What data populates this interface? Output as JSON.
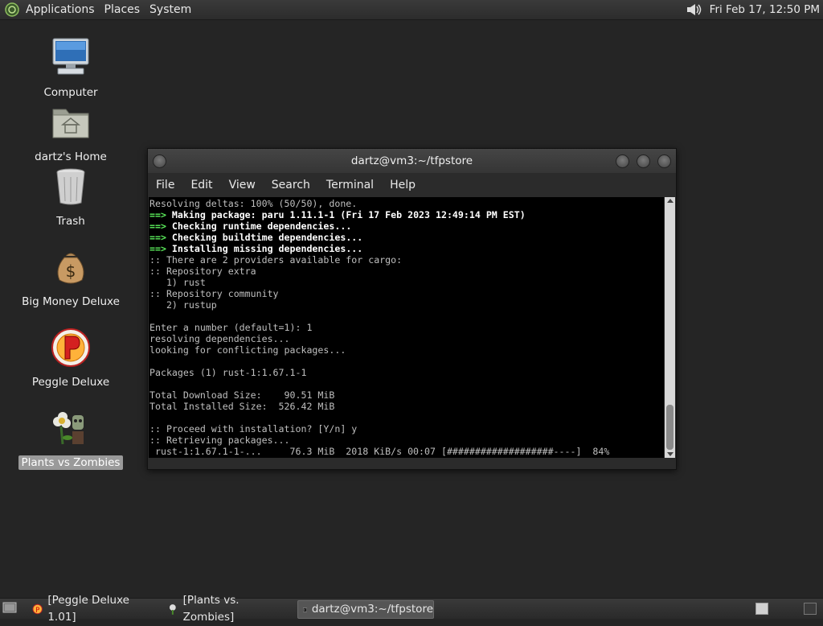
{
  "top_panel": {
    "menus": [
      "Applications",
      "Places",
      "System"
    ],
    "clock": "Fri Feb 17, 12:50 PM"
  },
  "desktop": {
    "icons": [
      {
        "label": "Computer",
        "icon": "computer-icon"
      },
      {
        "label": "dartz's Home",
        "icon": "home-folder-icon"
      },
      {
        "label": "Trash",
        "icon": "trash-icon"
      },
      {
        "label": "Big Money Deluxe",
        "icon": "money-bag-icon"
      },
      {
        "label": "Peggle Deluxe",
        "icon": "peggle-icon"
      },
      {
        "label": "Plants vs Zombies",
        "icon": "plants-vs-zombies-icon",
        "selected": true
      }
    ]
  },
  "terminal": {
    "title": "dartz@vm3:~/tfpstore",
    "menu": [
      "File",
      "Edit",
      "View",
      "Search",
      "Terminal",
      "Help"
    ],
    "lines": [
      {
        "text": "Resolving deltas: 100% (50/50), done."
      },
      {
        "arrow": "==>",
        "text": " Making package: paru 1.11.1-1 (Fri 17 Feb 2023 12:49:14 PM EST)",
        "bold": true
      },
      {
        "arrow": "==>",
        "text": " Checking runtime dependencies...",
        "bold": true
      },
      {
        "arrow": "==>",
        "text": " Checking buildtime dependencies...",
        "bold": true
      },
      {
        "arrow": "==>",
        "text": " Installing missing dependencies...",
        "bold": true
      },
      {
        "text": ":: There are 2 providers available for cargo:"
      },
      {
        "text": ":: Repository extra"
      },
      {
        "text": "   1) rust"
      },
      {
        "text": ":: Repository community"
      },
      {
        "text": "   2) rustup"
      },
      {
        "text": ""
      },
      {
        "text": "Enter a number (default=1): 1"
      },
      {
        "text": "resolving dependencies..."
      },
      {
        "text": "looking for conflicting packages..."
      },
      {
        "text": ""
      },
      {
        "text": "Packages (1) rust-1:1.67.1-1"
      },
      {
        "text": ""
      },
      {
        "text": "Total Download Size:    90.51 MiB"
      },
      {
        "text": "Total Installed Size:  526.42 MiB"
      },
      {
        "text": ""
      },
      {
        "text": ":: Proceed with installation? [Y/n] y"
      },
      {
        "text": ":: Retrieving packages..."
      },
      {
        "text": " rust-1:1.67.1-1-...     76.3 MiB  2018 KiB/s 00:07 [###################----]  84%"
      }
    ]
  },
  "taskbar": {
    "tasks": [
      {
        "label": "[Peggle Deluxe 1.01]",
        "icon": "peggle-icon"
      },
      {
        "label": "[Plants vs. Zombies]",
        "icon": "plants-vs-zombies-icon"
      },
      {
        "label": "dartz@vm3:~/tfpstore",
        "icon": "terminal-icon",
        "active": true
      }
    ]
  }
}
